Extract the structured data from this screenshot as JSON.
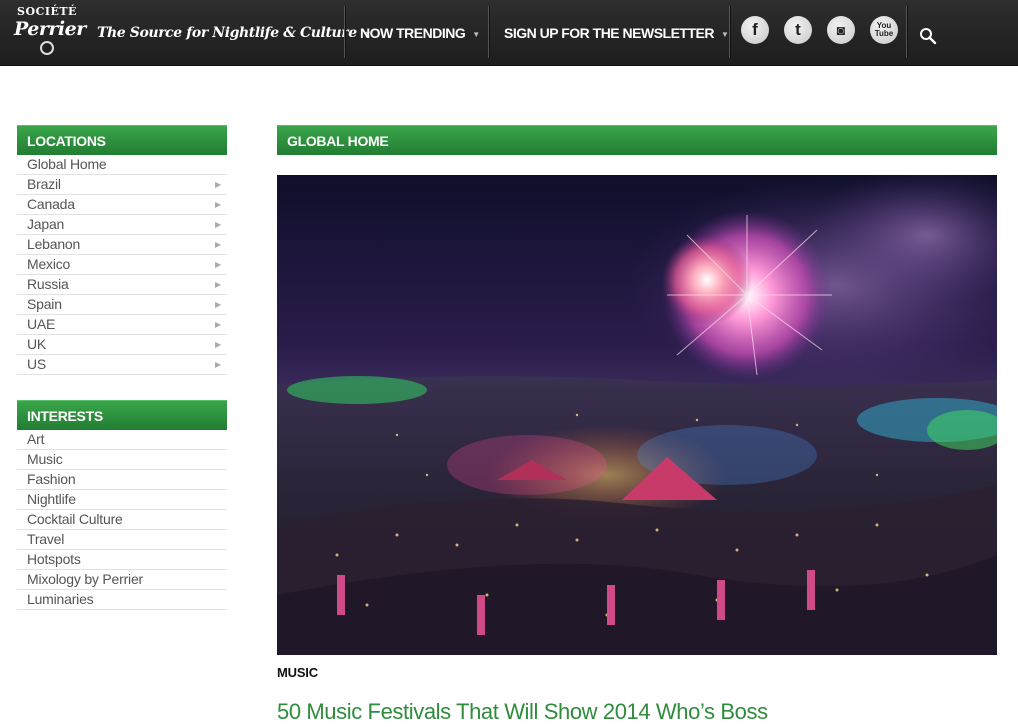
{
  "header": {
    "logo": {
      "line1": "SOCIÉTÉ",
      "line2": "Perrier"
    },
    "tagline": "The Source for Nightlife & Culture",
    "nav": [
      {
        "label": "NOW TRENDING"
      },
      {
        "label": "SIGN UP FOR THE NEWSLETTER"
      }
    ],
    "social": [
      {
        "icon": "facebook-icon",
        "glyph": "f"
      },
      {
        "icon": "twitter-icon",
        "glyph": "t"
      },
      {
        "icon": "instagram-icon",
        "glyph": "◙"
      },
      {
        "icon": "youtube-icon",
        "glyph_top": "You",
        "glyph_bottom": "Tube"
      }
    ],
    "search_icon": "search-icon"
  },
  "sidebar": {
    "locations": {
      "title": "LOCATIONS",
      "items": [
        "Global Home",
        "Brazil",
        "Canada",
        "Japan",
        "Lebanon",
        "Mexico",
        "Russia",
        "Spain",
        "UAE",
        "UK",
        "US"
      ]
    },
    "interests": {
      "title": "INTERESTS",
      "items": [
        "Art",
        "Music",
        "Fashion",
        "Nightlife",
        "Cocktail Culture",
        "Travel",
        "Hotspots",
        "Mixology by Perrier",
        "Luminaries"
      ]
    }
  },
  "main": {
    "section_title": "GLOBAL HOME",
    "feature": {
      "category": "MUSIC",
      "headline": "50 Music Festivals That Will Show 2014 Who’s Boss"
    }
  },
  "colors": {
    "accent_green": "#2f8c3d",
    "nav_bg": "#262626"
  }
}
